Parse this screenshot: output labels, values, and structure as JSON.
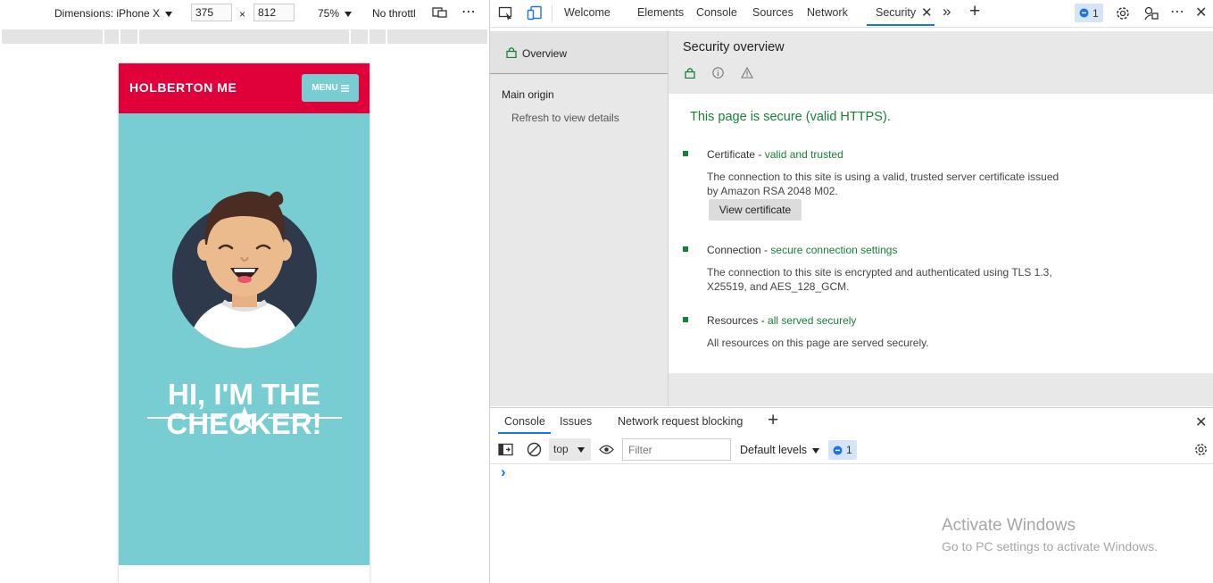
{
  "device_toolbar": {
    "dimensions_label": "Dimensions: iPhone X",
    "width_value": "375",
    "times": "×",
    "height_value": "812",
    "zoom_label": "75%",
    "throttle_label": "No throttl",
    "more": "⋯"
  },
  "site": {
    "title": "HOLBERTON ME",
    "menu_label": "MENU",
    "hero_line1": "HI, I'M THE",
    "hero_line2": "CHECKER!"
  },
  "devtools": {
    "tabs": [
      "Welcome",
      "Elements",
      "Console",
      "Sources",
      "Network",
      "Security"
    ],
    "issues_count": "1",
    "security": {
      "sidebar": {
        "overview": "Overview",
        "main_origin": "Main origin",
        "refresh": "Refresh to view details"
      },
      "heading": "Security overview",
      "summary": "This page is secure (valid HTTPS).",
      "items": [
        {
          "title": "Certificate",
          "status": "valid and trusted",
          "desc_line1": "The connection to this site is using a valid, trusted server certificate issued",
          "desc_line2": "by Amazon RSA 2048 M02."
        },
        {
          "title": "Connection",
          "status": "secure connection settings",
          "desc_line1": "The connection to this site is encrypted and authenticated using TLS 1.3,",
          "desc_line2": "X25519, and AES_128_GCM."
        },
        {
          "title": "Resources",
          "status": "all served securely",
          "desc_line1": "All resources on this page are served securely."
        }
      ],
      "view_certificate": "View certificate",
      "dash": " - "
    },
    "drawer": {
      "tabs": [
        "Console",
        "Issues",
        "Network request blocking"
      ],
      "context": "top",
      "filter_placeholder": "Filter",
      "levels": "Default levels",
      "issues_count": "1",
      "prompt": "›"
    }
  },
  "watermark": {
    "title": "Activate Windows",
    "subtitle": "Go to PC settings to activate Windows."
  },
  "colors": {
    "brand_red": "#e0003a",
    "hero_teal": "#78cdd2",
    "secure_green": "#188038",
    "accent_blue": "#1a73e8"
  }
}
